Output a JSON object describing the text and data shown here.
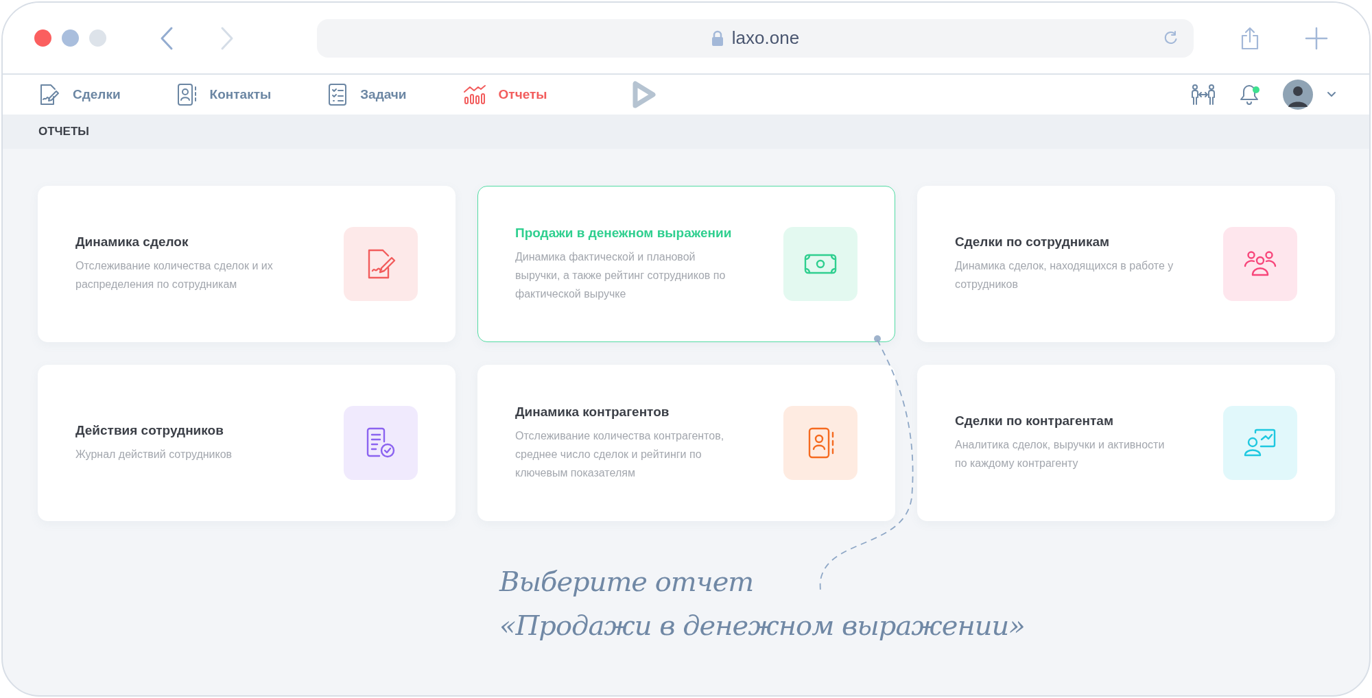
{
  "browser": {
    "url": "laxo.one"
  },
  "nav": {
    "items": [
      {
        "kind": "deals",
        "label": "Сделки",
        "selected": false
      },
      {
        "kind": "contacts",
        "label": "Контакты",
        "selected": false
      },
      {
        "kind": "tasks",
        "label": "Задачи",
        "selected": false
      },
      {
        "kind": "reports",
        "label": "Отчеты",
        "selected": true
      }
    ],
    "notification_dot": true
  },
  "breadcrumb": "ОТЧЕТЫ",
  "cards": [
    {
      "kind": "deals",
      "title": "Динамика сделок",
      "description": "Отслеживание количества сделок и их распределения по сотрудникам",
      "color": "#f25c5c",
      "selected": false
    },
    {
      "kind": "money",
      "title": "Продажи в денежном выражении",
      "description": "Динамика фактической и плановой выручки, а также рейтинг сотрудников по фактической выручке",
      "color": "#2fcf8f",
      "selected": true
    },
    {
      "kind": "team",
      "title": "Сделки по сотрудникам",
      "description": "Динамика сделок, находящихся в работе у сотрудников",
      "color": "#f7457a",
      "selected": false
    },
    {
      "kind": "log",
      "title": "Действия сотрудников",
      "description": "Журнал действий сотрудников",
      "color": "#8b63f0",
      "selected": false
    },
    {
      "kind": "contacts",
      "title": "Динамика контрагентов",
      "description": "Отслеживание количества контрагентов, среднее число сделок и рейтинги по ключевым показателям",
      "color": "#f56a1f",
      "selected": false
    },
    {
      "kind": "presenter",
      "title": "Сделки по контрагентам",
      "description": "Аналитика сделок, выручки и активности по каждому контрагенту",
      "color": "#1ec8e0",
      "selected": false
    }
  ],
  "annotation": {
    "lines": [
      "Выберите отчет",
      "«Продажи в денежном выражении»"
    ]
  }
}
